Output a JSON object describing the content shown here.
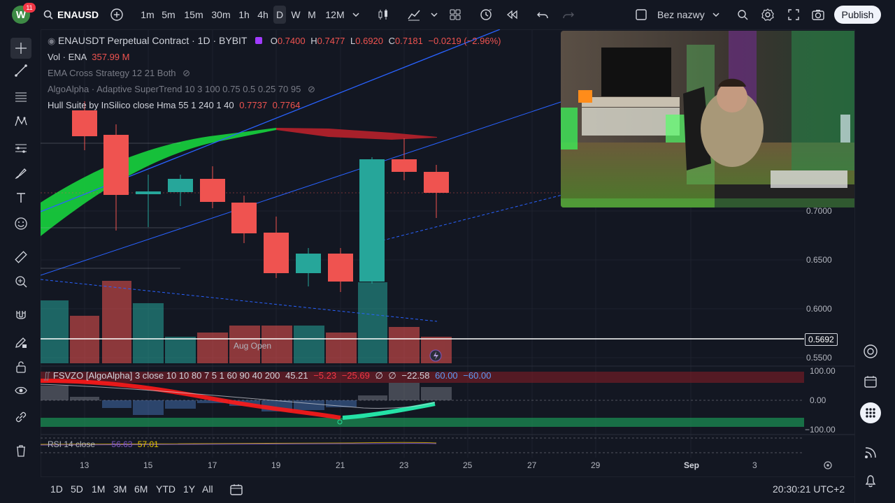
{
  "topbar": {
    "avatar_letter": "W",
    "avatar_badge": "11",
    "symbol": "ENAUSD",
    "intervals": [
      "1m",
      "5m",
      "15m",
      "30m",
      "1h",
      "4h",
      "D",
      "W",
      "M",
      "12M"
    ],
    "active_interval": "D",
    "layout_name": "Bez nazwy",
    "publish_label": "Publish"
  },
  "legend": {
    "title": "ENAUSDT Perpetual Contract · 1D · BYBIT",
    "o_label": "O",
    "o_value": "0.7400",
    "h_label": "H",
    "h_value": "0.7477",
    "l_label": "L",
    "l_value": "0.6920",
    "c_label": "C",
    "c_value": "0.7181",
    "change": "−0.0219 (−2.96%)",
    "vol_label": "Vol · ENA",
    "vol_value": "357.99 M",
    "ind1": "EMA Cross Strategy 12 21 Both",
    "ind2": "AlgoAlpha · Adaptive SuperTrend 10 3 100 0.75 0.5 0.25 70 95",
    "ind3_label": "Hull Suite by InSilico close Hma 55 1 240 1 40",
    "ind3_v1": "0.7737",
    "ind3_v2": "0.7764",
    "aug_open": "Aug Open"
  },
  "price_axis": {
    "p1": "0.7000",
    "p2": "0.6500",
    "p3": "0.6000",
    "p4": "0.5500",
    "current": "0.5692",
    "osc_top": "100.00",
    "osc_mid": "0.00",
    "osc_bot": "−100.00"
  },
  "oscillator": {
    "name": "FSVZO [AlgoAlpha] 3 close 10 10 80 7 5 1 60 90 40 200",
    "v1": "45.21",
    "v2": "−5.23",
    "v3": "−25.69",
    "v4": "∅",
    "v5": "∅",
    "v6": "−22.58",
    "v7": "60.00",
    "v8": "−60.00"
  },
  "rsi": {
    "label": "RSI 14 close",
    "v1": "56.63",
    "v2": "57.01"
  },
  "dates": [
    "13",
    "15",
    "17",
    "19",
    "21",
    "23",
    "25",
    "27",
    "29",
    "Sep",
    "3"
  ],
  "bottombar": {
    "ranges": [
      "1D",
      "5D",
      "1M",
      "3M",
      "6M",
      "YTD",
      "1Y",
      "All"
    ],
    "clock": "20:30:21 UTC+2"
  },
  "colors": {
    "up": "#26a69a",
    "down": "#ef5350",
    "bg": "#131722",
    "accent": "#2962ff"
  }
}
